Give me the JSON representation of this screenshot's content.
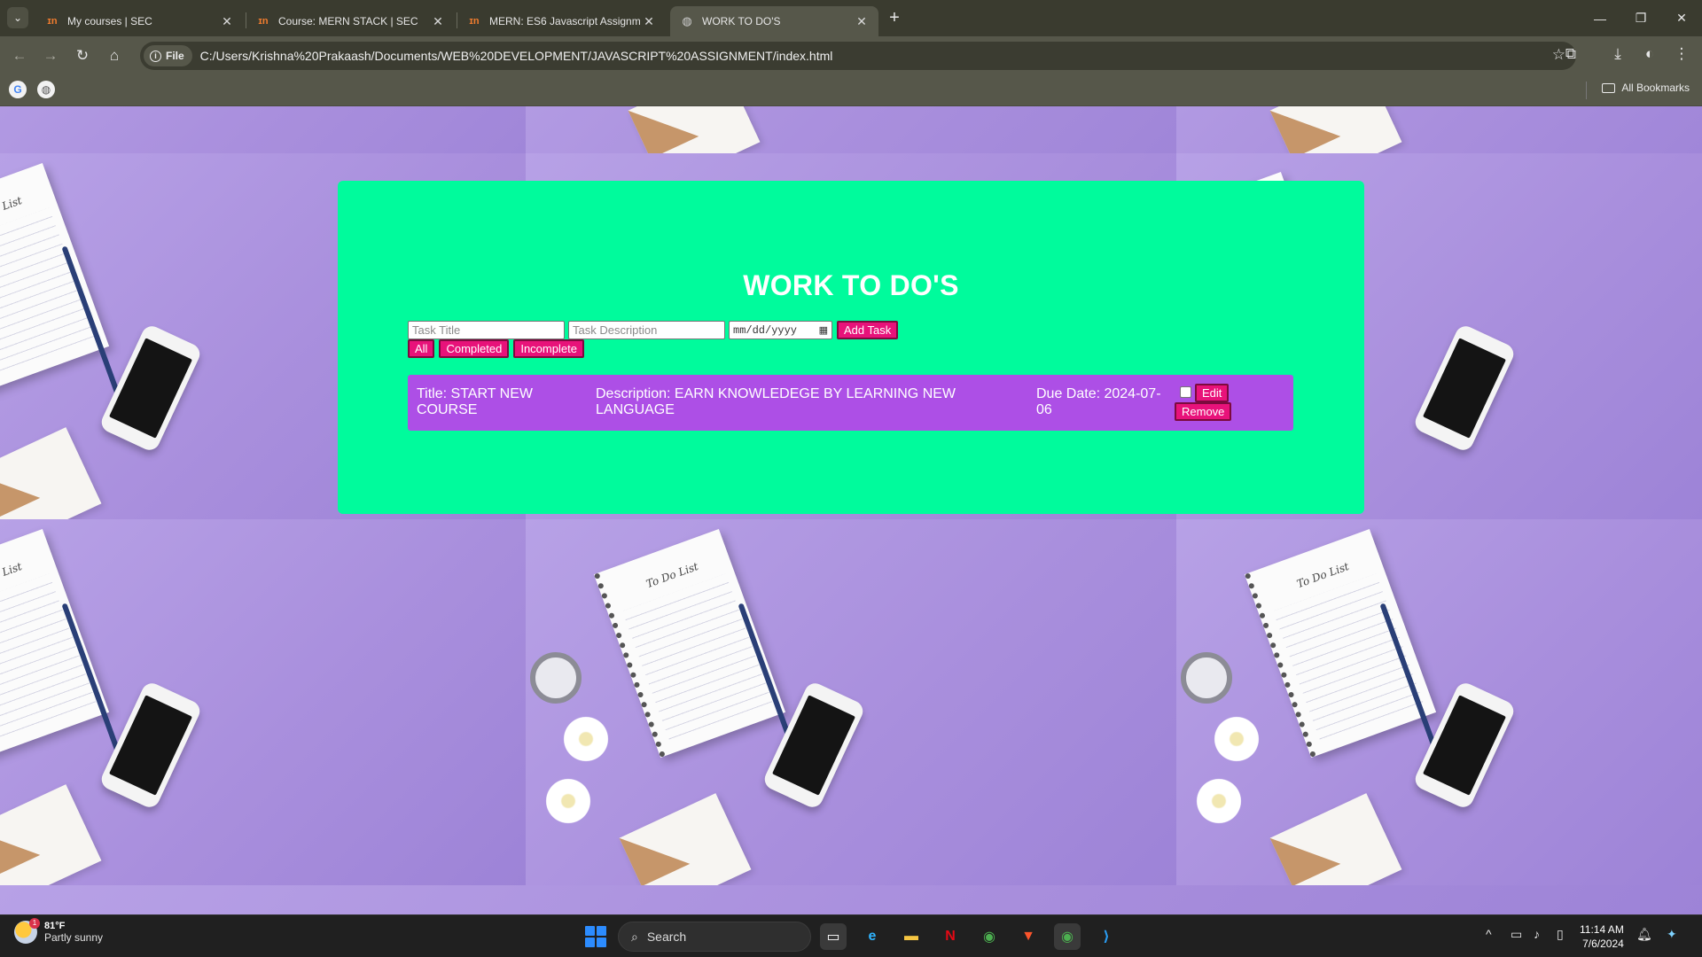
{
  "browser": {
    "tabs": [
      {
        "title": "My courses | SEC",
        "favicon": "course-logo-icon"
      },
      {
        "title": "Course: MERN STACK | SEC",
        "favicon": "course-logo-icon"
      },
      {
        "title": "MERN: ES6 Javascript Assignme",
        "favicon": "course-logo-icon"
      },
      {
        "title": "WORK TO DO'S",
        "favicon": "globe-icon",
        "active": true
      }
    ],
    "address": {
      "chip_label": "File",
      "url": "C:/Users/Krishna%20Prakaash/Documents/WEB%20DEVELOPMENT/JAVASCRIPT%20ASSIGNMENT/index.html"
    },
    "bookmarks": {
      "all_label": "All Bookmarks"
    }
  },
  "app": {
    "heading": "WORK TO DO'S",
    "form": {
      "title_placeholder": "Task Title",
      "description_placeholder": "Task Description",
      "date_placeholder": "mm/dd/yyyy",
      "add_label": "Add Task"
    },
    "filters": [
      "All",
      "Completed",
      "Incomplete"
    ],
    "tasks": [
      {
        "title": "Title: START NEW COURSE",
        "description": "Description: EARN KNOWLEDEGE BY LEARNING NEW LANGUAGE",
        "due": "Due Date: 2024-07-06",
        "completed": false,
        "edit_label": "Edit",
        "remove_label": "Remove"
      }
    ],
    "colors": {
      "card": "#00fb9c",
      "task": "#ad4fe6",
      "button": "#e8127a"
    }
  },
  "taskbar": {
    "weather": {
      "temp": "81°F",
      "condition": "Partly sunny",
      "badge": "1"
    },
    "search_label": "Search",
    "time": "11:14 AM",
    "date": "7/6/2024"
  }
}
